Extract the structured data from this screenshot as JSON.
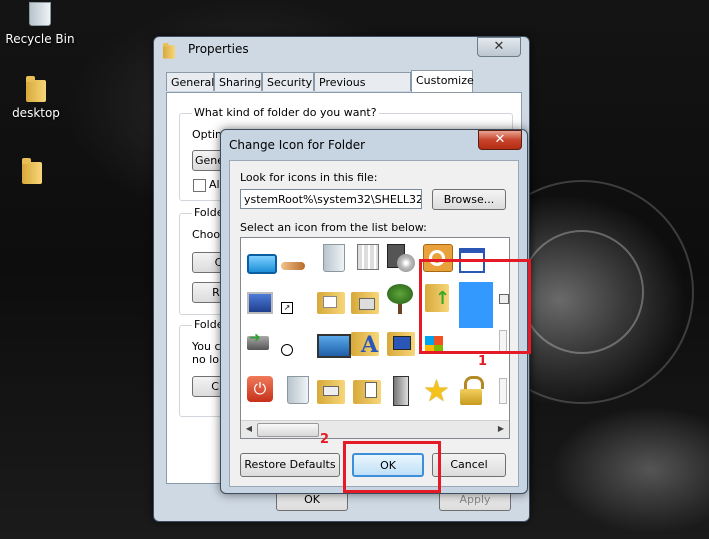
{
  "desktop": {
    "icons": [
      {
        "label": "Recycle Bin"
      },
      {
        "label": "desktop"
      },
      {
        "label": ""
      }
    ]
  },
  "properties": {
    "title": "Properties",
    "tabs": [
      "General",
      "Sharing",
      "Security",
      "Previous Versions",
      "Customize"
    ],
    "active_tab": "Customize",
    "question": "What kind of folder do you want?",
    "optimize_label": "Optimize this folder for:",
    "optimize_value": "Gene",
    "also_apply_label": "Also",
    "folder_pictures_label": "Folder",
    "choose_label": "Choos",
    "choose_file_btn": "Ch",
    "restore_btn": "Res",
    "folder_icons_label": "Folder",
    "folder_icons_text1": "You c",
    "folder_icons_text2": "no lon",
    "change_icon_btn": "Cha",
    "ok_btn": "OK",
    "apply_btn": "Apply"
  },
  "dialog": {
    "title": "Change Icon for  Folder",
    "look_label": "Look for icons in this file:",
    "file_path": "ystemRoot%\\system32\\SHELL32.dll",
    "browse_btn": "Browse...",
    "list_label": "Select an icon from the list below:",
    "restore_defaults_btn": "Restore Defaults",
    "ok_btn": "OK",
    "cancel_btn": "Cancel"
  },
  "annotations": {
    "one": "1",
    "two": "2",
    "color": "#e41b26"
  },
  "colors": {
    "selected_icon": "#3399ff",
    "close_red": "#c7432a"
  }
}
